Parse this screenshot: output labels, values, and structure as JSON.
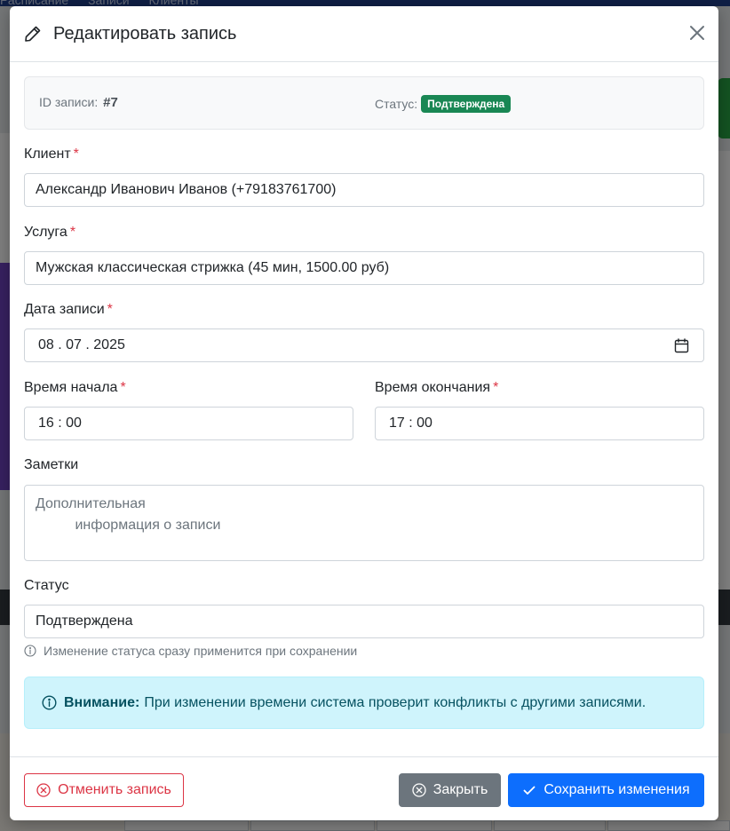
{
  "background": {
    "nav_items": [
      "Расписание",
      "Записи",
      "Клиенты"
    ]
  },
  "modal": {
    "title": "Редактировать запись",
    "info": {
      "id_label": "ID записи:",
      "id_value": "#7",
      "status_label": "Статус:",
      "status_badge": "Подтверждена"
    },
    "fields": {
      "client": {
        "label": "Клиент",
        "required": "*",
        "value": "Александр Иванович Иванов (+79183761700)"
      },
      "service": {
        "label": "Услуга",
        "required": "*",
        "value": "Мужская классическая стрижка (45 мин, 1500.00 руб)"
      },
      "date": {
        "label": "Дата записи",
        "required": "*",
        "value": "08 . 07 . 2025"
      },
      "start_time": {
        "label": "Время начала",
        "required": "*",
        "value": "16 : 00"
      },
      "end_time": {
        "label": "Время окончания",
        "required": "*",
        "value": "17 : 00"
      },
      "notes": {
        "label": "Заметки",
        "placeholder": "Дополнительная\n          информация о записи"
      },
      "status": {
        "label": "Статус",
        "value": "Подтверждена",
        "help": "Изменение статуса сразу применится при сохранении"
      }
    },
    "alert": {
      "title": "Внимание:",
      "text": "При изменении времени система проверит конфликты с другими записями."
    },
    "footer": {
      "cancel_label": "Отменить запись",
      "close_label": "Закрыть",
      "save_label": "Сохранить изменения"
    }
  },
  "colors": {
    "primary": "#0d6efd",
    "secondary": "#6c757d",
    "danger": "#dc3545",
    "success": "#198754",
    "info_bg": "#cff4fc",
    "info_text": "#055160"
  },
  "icons": {
    "header": "pencil-icon",
    "close": "close-icon",
    "date": "calendar-icon",
    "info": "info-circle-icon",
    "cancel": "x-circle-icon",
    "check": "check-icon"
  }
}
